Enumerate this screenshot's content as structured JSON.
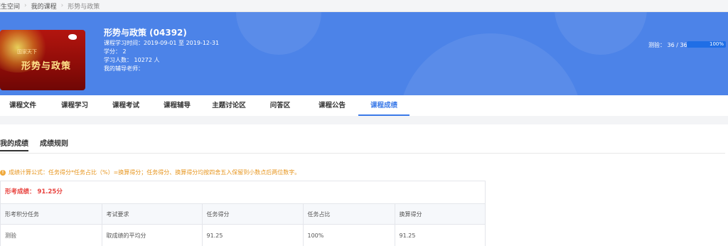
{
  "breadcrumb": [
    "校生空间",
    "我的课程",
    "形势与政策"
  ],
  "course": {
    "cover_text_small": "国家天下",
    "cover_text_big": "形势与政策",
    "title": "形势与政策 (04392)",
    "time": "课程学习时间：2019-09-01 至 2019-12-31",
    "credits": "学分： 2",
    "learners": "学习人数： 10272 人",
    "tutor": "我的辅导老师："
  },
  "progress": {
    "label": "测验： 36 / 36",
    "percent": 100,
    "percent_text": "100%"
  },
  "tabs": [
    "课程文件",
    "课程学习",
    "课程考试",
    "课程辅导",
    "主题讨论区",
    "问答区",
    "课程公告",
    "课程成绩"
  ],
  "active_tab": 7,
  "subtabs": [
    "我的成绩",
    "成绩规则"
  ],
  "formula": "成绩计算公式：任务得分*任务占比（%）=换算得分；任务得分、换算得分均按四舍五入保留到小数点后两位数字。",
  "score": {
    "total": "形考成绩： 91.25分",
    "columns": [
      "形考积分任务",
      "考试要求",
      "任务得分",
      "任务占比",
      "换算得分"
    ],
    "rows": [
      [
        "测验",
        "取成绩的平均分",
        "91.25",
        "100%",
        "91.25"
      ]
    ]
  },
  "colors": {
    "banner": "#4c83e8",
    "accent": "#3b7ae8",
    "score_red": "#e8403c",
    "warning": "#e7961f"
  }
}
